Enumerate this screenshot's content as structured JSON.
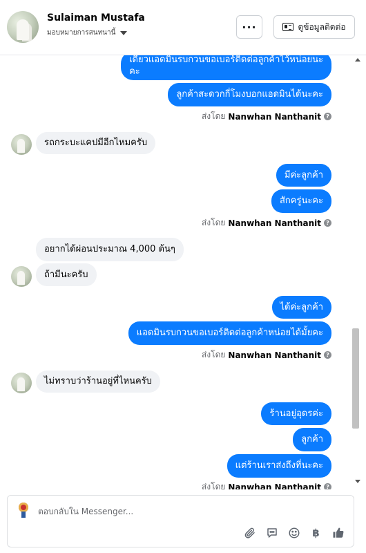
{
  "header": {
    "contact_name": "Sulaiman Mustafa",
    "assign_label": "มอบหมายการสนทนานี้",
    "more_label": "···",
    "contact_info_label": "ดูข้อมูลติดต่อ"
  },
  "thread": {
    "messages": [
      {
        "dir": "out",
        "text": "เดี๋ยวแอดมินรบกวนขอเบอร์ติดต่อลูกค้าไว้หน่อยนะ"
      },
      {
        "dir": "out",
        "text": "คะ"
      },
      {
        "dir": "out",
        "text": "ลูกค้าสะดวกกี่โมงบอกแอดมินได้นะคะ"
      },
      {
        "dir": "in",
        "text": "รถกระบะแคปมีอีกไหมครับ"
      },
      {
        "dir": "out",
        "text": "มีค่ะลูกค้า"
      },
      {
        "dir": "out",
        "text": "สักครู่นะคะ"
      },
      {
        "dir": "in",
        "text": "อยากได้ผ่อนประมาณ 4,000 ต้นๆ"
      },
      {
        "dir": "in",
        "text": "ถ้ามีนะครับ"
      },
      {
        "dir": "out",
        "text": "ได้ค่ะลูกค้า"
      },
      {
        "dir": "out",
        "text": "แอดมินรบกวนขอเบอร์ติดต่อลูกค้าหน่อยได้มั้ยคะ"
      },
      {
        "dir": "in",
        "text": "ไม่ทราบว่าร้านอยู่ที่ไหนครับ"
      },
      {
        "dir": "out",
        "text": "ร้านอยู่อุดรค่ะ"
      },
      {
        "dir": "out",
        "text": "ลูกค้า"
      },
      {
        "dir": "out",
        "text": "แต่ร้านเราส่งถึงที่นะคะ"
      }
    ],
    "sent_by_prefix": "ส่งโดย",
    "sent_by_name": "Nanwhan Nanthanit",
    "help_mark": "?"
  },
  "composer": {
    "placeholder": "ตอบกลับใน Messenger...",
    "icons": [
      "paperclip-icon",
      "quick-reply-icon",
      "emoji-icon",
      "baht-icon",
      "like-icon"
    ],
    "baht_symbol": "฿"
  },
  "colors": {
    "outgoing_bubble": "#0b7cff",
    "incoming_bubble": "#f0f2f5",
    "secondary_text": "#65676b"
  }
}
